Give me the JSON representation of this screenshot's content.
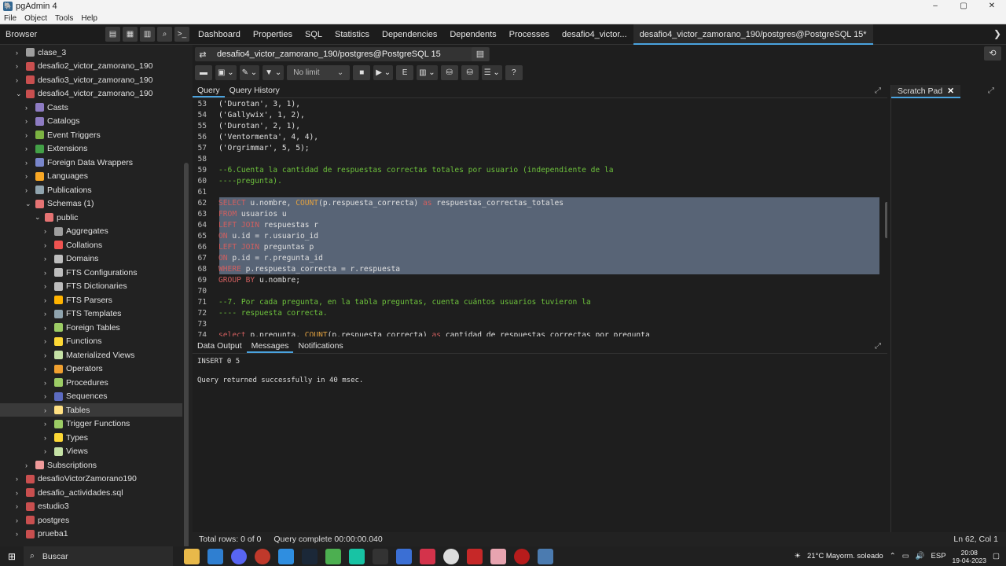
{
  "window": {
    "title": "pgAdmin 4",
    "controls": [
      "–",
      "▢",
      "✕"
    ]
  },
  "menu": [
    "File",
    "Object",
    "Tools",
    "Help"
  ],
  "browser_label": "Browser",
  "main_tabs": [
    "Dashboard",
    "Properties",
    "SQL",
    "Statistics",
    "Dependencies",
    "Dependents",
    "Processes",
    "desafio4_victor...",
    "desafio4_victor_zamorano_190/postgres@PostgreSQL 15*"
  ],
  "tree": [
    {
      "label": "clase_3",
      "caret": "›"
    },
    {
      "label": "desafio2_victor_zamorano_190",
      "caret": "›"
    },
    {
      "label": "desafio3_victor_zamorano_190",
      "caret": "›"
    },
    {
      "label": "desafio4_victor_zamorano_190",
      "caret": "⌄"
    },
    {
      "label": "Casts",
      "caret": "›"
    },
    {
      "label": "Catalogs",
      "caret": "›"
    },
    {
      "label": "Event Triggers",
      "caret": "›"
    },
    {
      "label": "Extensions",
      "caret": "›"
    },
    {
      "label": "Foreign Data Wrappers",
      "caret": "›"
    },
    {
      "label": "Languages",
      "caret": "›"
    },
    {
      "label": "Publications",
      "caret": "›"
    },
    {
      "label": "Schemas (1)",
      "caret": "⌄"
    },
    {
      "label": "public",
      "caret": "⌄"
    },
    {
      "label": "Aggregates",
      "caret": "›"
    },
    {
      "label": "Collations",
      "caret": "›"
    },
    {
      "label": "Domains",
      "caret": "›"
    },
    {
      "label": "FTS Configurations",
      "caret": "›"
    },
    {
      "label": "FTS Dictionaries",
      "caret": "›"
    },
    {
      "label": "FTS Parsers",
      "caret": "›"
    },
    {
      "label": "FTS Templates",
      "caret": "›"
    },
    {
      "label": "Foreign Tables",
      "caret": "›"
    },
    {
      "label": "Functions",
      "caret": "›"
    },
    {
      "label": "Materialized Views",
      "caret": "›"
    },
    {
      "label": "Operators",
      "caret": "›"
    },
    {
      "label": "Procedures",
      "caret": "›"
    },
    {
      "label": "Sequences",
      "caret": "›"
    },
    {
      "label": "Tables",
      "caret": "›"
    },
    {
      "label": "Trigger Functions",
      "caret": "›"
    },
    {
      "label": "Types",
      "caret": "›"
    },
    {
      "label": "Views",
      "caret": "›"
    },
    {
      "label": "Subscriptions",
      "caret": "›"
    },
    {
      "label": "desafioVictorZamorano190",
      "caret": "›"
    },
    {
      "label": "desafio_actividades.sql",
      "caret": "›"
    },
    {
      "label": "estudio3",
      "caret": "›"
    },
    {
      "label": "postgres",
      "caret": "›"
    },
    {
      "label": "prueba1",
      "caret": "›"
    }
  ],
  "connection": "desafio4_victor_zamorano_190/postgres@PostgreSQL 15",
  "no_limit": "No limit",
  "query_tabs": [
    "Query",
    "Query History"
  ],
  "scratch_pad": "Scratch Pad",
  "code": [
    {
      "n": "53",
      "t": "('Durotan', 3, 1),"
    },
    {
      "n": "54",
      "t": "('Gallywix', 1, 2),"
    },
    {
      "n": "55",
      "t": "('Durotan', 2, 1),"
    },
    {
      "n": "56",
      "t": "('Ventormenta', 4, 4),"
    },
    {
      "n": "57",
      "t": "('Orgrimmar', 5, 5);"
    },
    {
      "n": "58",
      "t": ""
    },
    {
      "n": "59",
      "t": "--6.Cuenta la cantidad de respuestas correctas totales por usuario (independiente de la"
    },
    {
      "n": "60",
      "t": "----pregunta)."
    },
    {
      "n": "61",
      "t": ""
    },
    {
      "n": "62",
      "t": "SELECT u.nombre, COUNT(p.respuesta_correcta) as respuestas_correctas_totales"
    },
    {
      "n": "63",
      "t": "FROM usuarios u"
    },
    {
      "n": "64",
      "t": "LEFT JOIN respuestas r"
    },
    {
      "n": "65",
      "t": "ON u.id = r.usuario_id"
    },
    {
      "n": "66",
      "t": "LEFT JOIN preguntas p"
    },
    {
      "n": "67",
      "t": "ON p.id = r.pregunta_id"
    },
    {
      "n": "68",
      "t": "WHERE p.respuesta_correcta = r.respuesta"
    },
    {
      "n": "69",
      "t": "GROUP BY u.nombre;"
    },
    {
      "n": "70",
      "t": ""
    },
    {
      "n": "71",
      "t": "--7. Por cada pregunta, en la tabla preguntas, cuenta cuántos usuarios tuvieron la"
    },
    {
      "n": "72",
      "t": "---- respuesta correcta."
    },
    {
      "n": "73",
      "t": ""
    },
    {
      "n": "74",
      "t": "select p.pregunta, COUNT(p.respuesta_correcta) as cantidad_de_respuestas_correctas_por_pregunta"
    }
  ],
  "output_tabs": [
    "Data Output",
    "Messages",
    "Notifications"
  ],
  "messages": [
    "INSERT 0 5",
    "Query returned successfully in 40 msec."
  ],
  "status": {
    "rows": "Total rows: 0 of 0",
    "complete": "Query complete 00:00:00.040",
    "pos": "Ln 62, Col 1"
  },
  "taskbar": {
    "search": "Buscar",
    "weather": "21°C  Mayorm. soleado",
    "lang": "ESP",
    "time": "20:08",
    "date": "19-04-2023"
  }
}
